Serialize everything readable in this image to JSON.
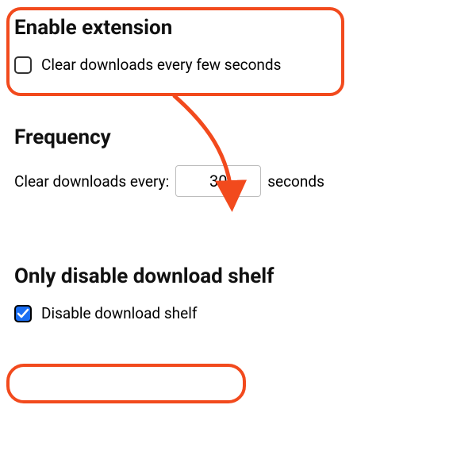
{
  "sections": {
    "enable": {
      "heading": "Enable extension",
      "checkbox_label": "Clear downloads every few seconds",
      "checked": false
    },
    "frequency": {
      "heading": "Frequency",
      "label_before": "Clear downloads every:",
      "value": "30",
      "label_after": "seconds"
    },
    "shelf": {
      "heading": "Only disable download shelf",
      "checkbox_label": "Disable download shelf",
      "checked": true
    }
  },
  "annotation": {
    "color": "#f24a1d"
  }
}
